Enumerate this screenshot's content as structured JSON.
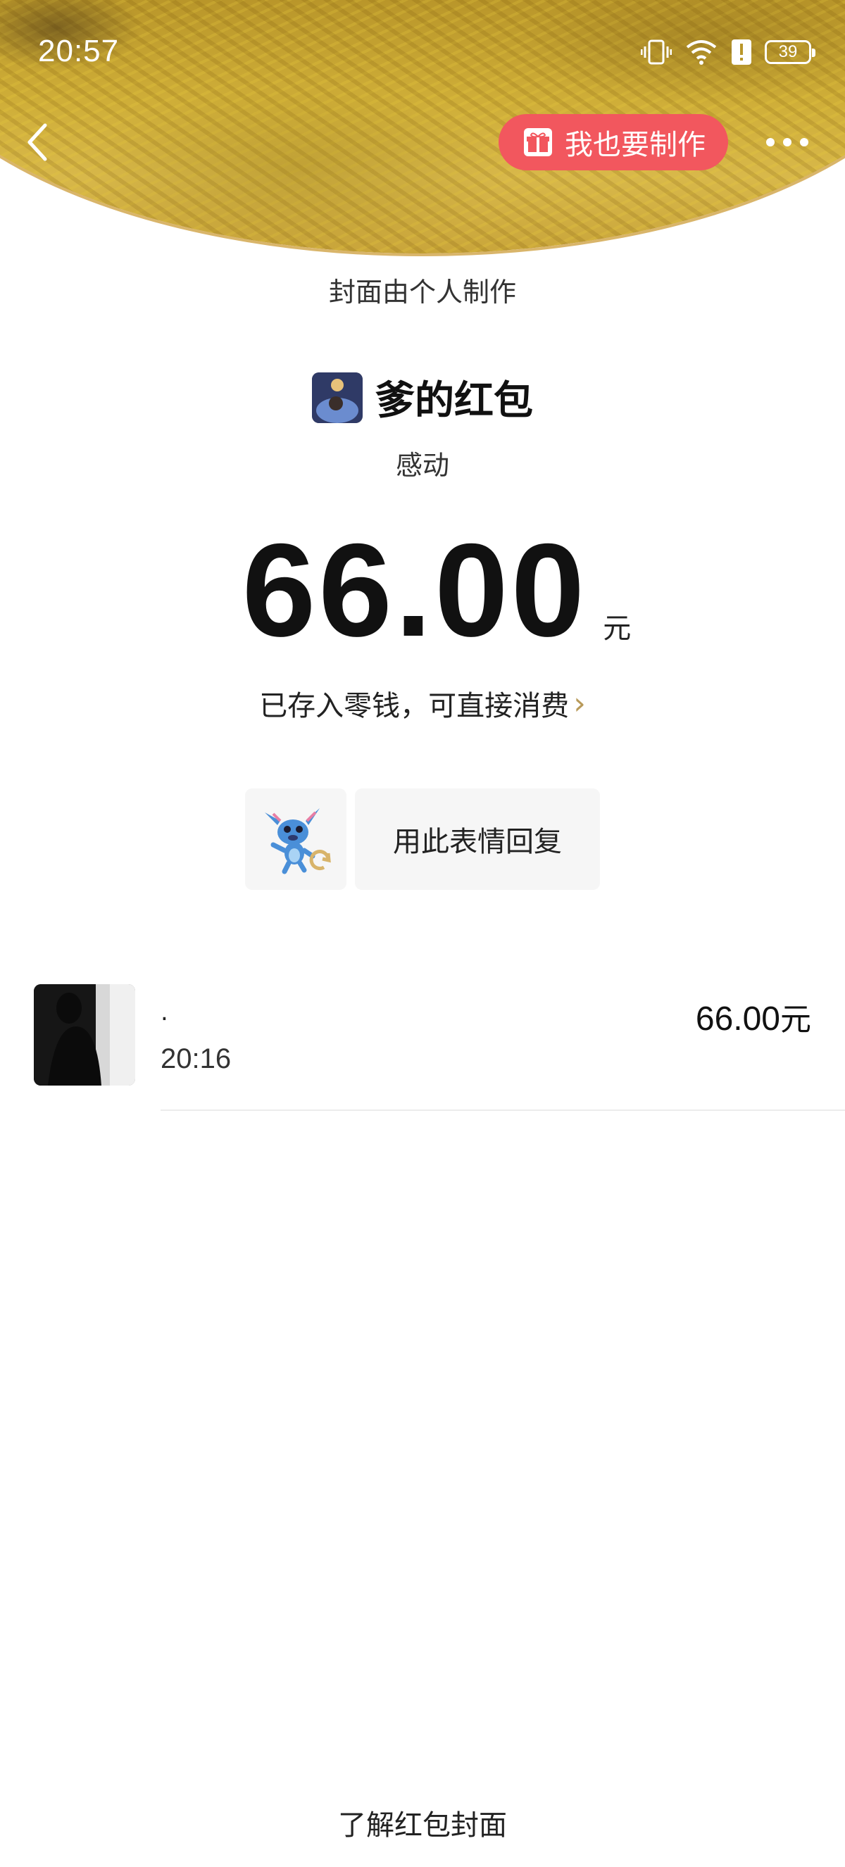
{
  "status_bar": {
    "time": "20:57",
    "battery": "39",
    "icons": [
      "vibrate-icon",
      "wifi-icon",
      "alert-icon",
      "battery-icon"
    ]
  },
  "header": {
    "make_button_label": "我也要制作",
    "cover_note": "封面由个人制作"
  },
  "packet": {
    "sender_name": "爹的红包",
    "message": "感动",
    "amount": "66.00",
    "amount_unit": "元",
    "stored_note": "已存入零钱，可直接消费"
  },
  "reply": {
    "button_label": "用此表情回复"
  },
  "records": [
    {
      "name": ".",
      "time": "20:16",
      "amount": "66.00",
      "unit": "元"
    }
  ],
  "footer": {
    "link_label": "了解红包封面"
  },
  "colors": {
    "make_button": "#f2575e",
    "accent_gold": "#b89a5a",
    "panel_bg": "#f6f6f6"
  }
}
